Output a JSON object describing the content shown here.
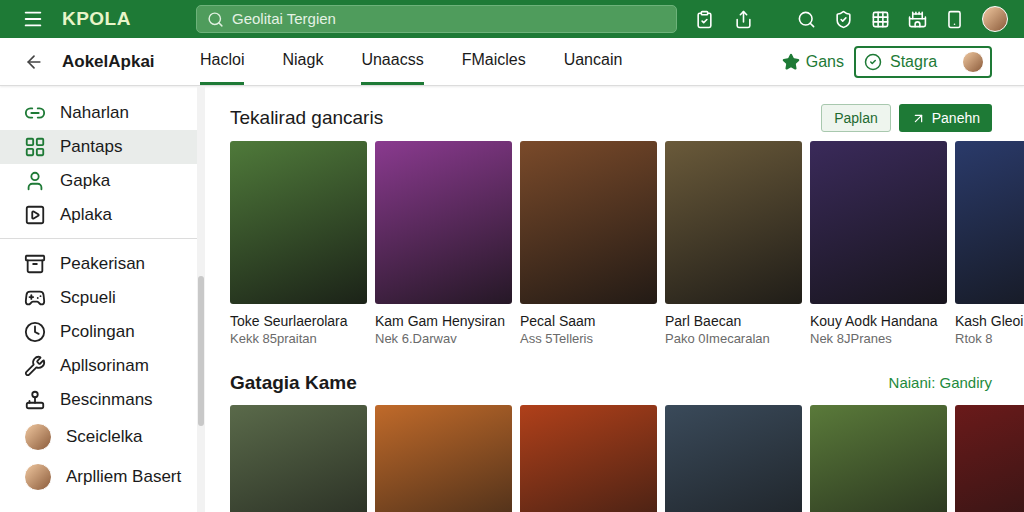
{
  "app": {
    "logo": "KPOLA",
    "search_placeholder": "Geolitai Tergien"
  },
  "header": {
    "title": "AokelApkai",
    "tabs": [
      {
        "label": "Hacloi",
        "selected": true
      },
      {
        "label": "Niagk",
        "selected": false
      },
      {
        "label": "Unaacss",
        "selected": true
      },
      {
        "label": "FMaicles",
        "selected": false
      },
      {
        "label": "Uancain",
        "selected": false
      }
    ],
    "favorite": "Gans",
    "action": "Stagra"
  },
  "sidebar": {
    "groups": [
      [
        {
          "label": "Naharlan",
          "kind": "icon",
          "selected": false
        },
        {
          "label": "Pantaps",
          "kind": "icon",
          "selected": true
        },
        {
          "label": "Gapka",
          "kind": "icon",
          "selected": false
        },
        {
          "label": "Aplaka",
          "kind": "icon",
          "selected": false
        }
      ],
      [
        {
          "label": "Peakerisan",
          "kind": "icon",
          "selected": false
        },
        {
          "label": "Scpueli",
          "kind": "icon",
          "selected": false
        },
        {
          "label": "Pcolingan",
          "kind": "icon",
          "selected": false
        },
        {
          "label": "Apllsorinam",
          "kind": "icon",
          "selected": false
        },
        {
          "label": "Bescinmans",
          "kind": "icon",
          "selected": false
        },
        {
          "label": "Sceiclelka",
          "kind": "avatar",
          "selected": false
        },
        {
          "label": "Arplliem Basert",
          "kind": "avatar",
          "selected": false
        }
      ]
    ]
  },
  "sections": [
    {
      "title": "Tekalirad gancaris",
      "buttons": [
        {
          "label": "Paplan",
          "primary": false
        },
        {
          "label": "Panehn",
          "primary": true
        }
      ],
      "cards": [
        {
          "title": "Toke Seurlaerolara",
          "subtitle": "Kekk 85praitan",
          "color": "#4f7a3a"
        },
        {
          "title": "Kam Gam Henysiran",
          "subtitle": "Nek 6.Darwav",
          "color": "#8a3a8f"
        },
        {
          "title": "Pecal Saam",
          "subtitle": "Ass 5Telleris",
          "color": "#7a4a2a"
        },
        {
          "title": "Parl Baecan",
          "subtitle": "Pako 0Imecaralan",
          "color": "#6a5a3a"
        },
        {
          "title": "Kouy Aodk Handana",
          "subtitle": "Nek 8JPranes",
          "color": "#3a2a5a"
        },
        {
          "title": "Kash Gleoi",
          "subtitle": "Rtok 8",
          "color": "#2a3a6a"
        }
      ]
    },
    {
      "title": "Gatagia Kame",
      "link": "Naiani: Gandiry",
      "cards": [
        {
          "color": "#5a6a4a"
        },
        {
          "color": "#c06a2a"
        },
        {
          "color": "#b0401a"
        },
        {
          "color": "#3a4a5a"
        },
        {
          "color": "#5a7a3a"
        },
        {
          "color": "#6a1a1a"
        }
      ]
    }
  ]
}
